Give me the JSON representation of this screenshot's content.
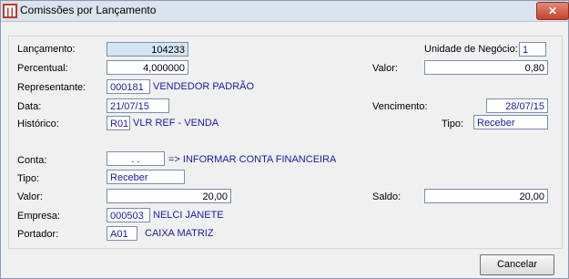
{
  "window": {
    "title": "Comissões por Lançamento",
    "close_glyph": "✕"
  },
  "fields": {
    "lancamento": {
      "label": "Lançamento:",
      "value": "104233"
    },
    "unidade": {
      "label": "Unidade de Negócio:",
      "value": "1"
    },
    "percentual": {
      "label": "Percentual:",
      "value": "4,000000"
    },
    "valor_top": {
      "label": "Valor:",
      "value": "0,80"
    },
    "representante": {
      "label": "Representante:",
      "code": "000181",
      "name": "VENDEDOR PADRÃO"
    },
    "data": {
      "label": "Data:",
      "value": "21/07/15"
    },
    "vencimento": {
      "label": "Vencimento:",
      "value": "28/07/15"
    },
    "historico": {
      "label": "Histórico:",
      "code": "R01",
      "name": "VLR REF - VENDA"
    },
    "tipo_top": {
      "label": "Tipo:",
      "value": "Receber"
    },
    "conta": {
      "label": "Conta:",
      "value": ". .",
      "note": "=> INFORMAR CONTA FINANCEIRA"
    },
    "tipo": {
      "label": "Tipo:",
      "value": "Receber"
    },
    "valor": {
      "label": "Valor:",
      "value": "20,00"
    },
    "saldo": {
      "label": "Saldo:",
      "value": "20,00"
    },
    "empresa": {
      "label": "Empresa:",
      "code": "000503",
      "name": "NELCI JANETE"
    },
    "portador": {
      "label": "Portador:",
      "code": "A01",
      "name": "CAIXA MATRIZ"
    }
  },
  "buttons": {
    "cancel": "Cancelar"
  },
  "colors": {
    "link_text": "#1a1aa8",
    "title_bar": "#dbe3ee",
    "close_button": "#c5432d"
  }
}
